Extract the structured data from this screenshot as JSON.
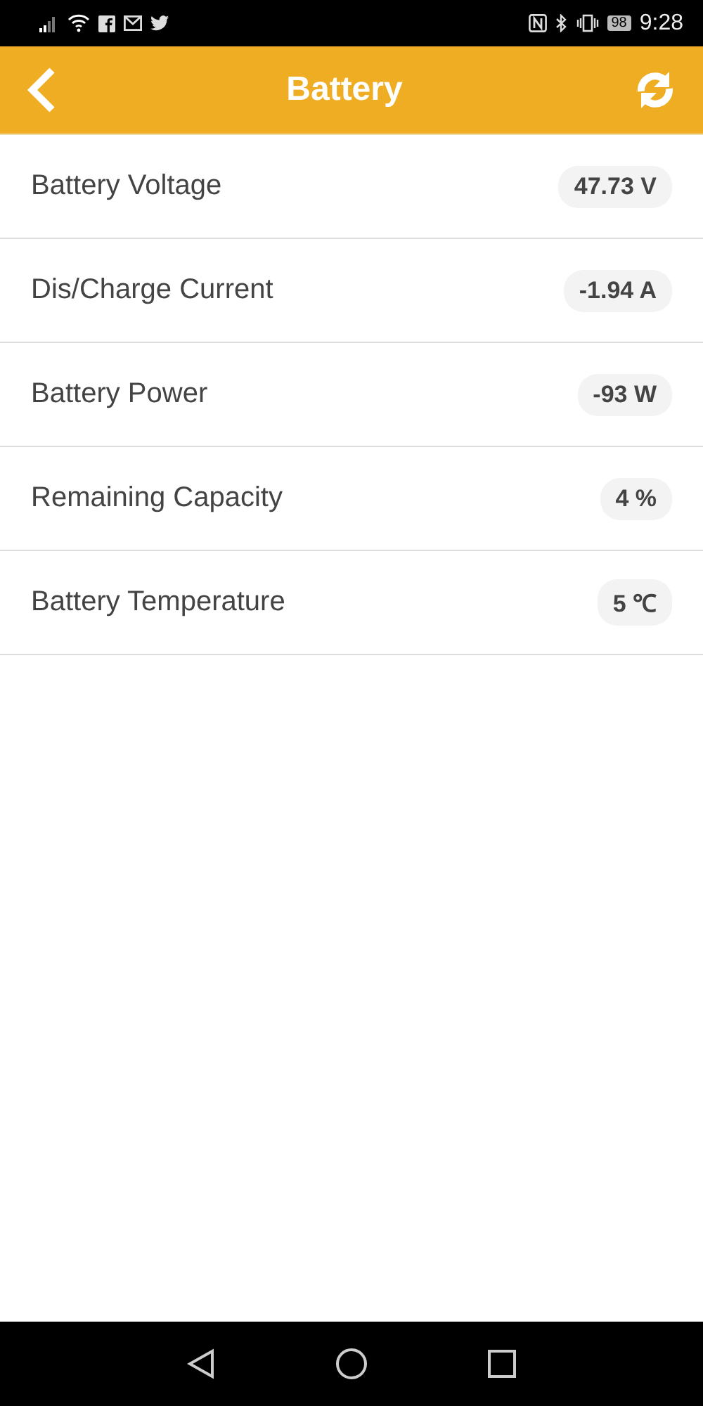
{
  "status_bar": {
    "battery": "98",
    "time": "9:28"
  },
  "header": {
    "title": "Battery"
  },
  "rows": [
    {
      "label": "Battery Voltage",
      "value": "47.73 V"
    },
    {
      "label": "Dis/Charge Current",
      "value": "-1.94 A"
    },
    {
      "label": "Battery Power",
      "value": "-93 W"
    },
    {
      "label": "Remaining Capacity",
      "value": "4 %"
    },
    {
      "label": "Battery Temperature",
      "value": "5 ℃"
    }
  ]
}
